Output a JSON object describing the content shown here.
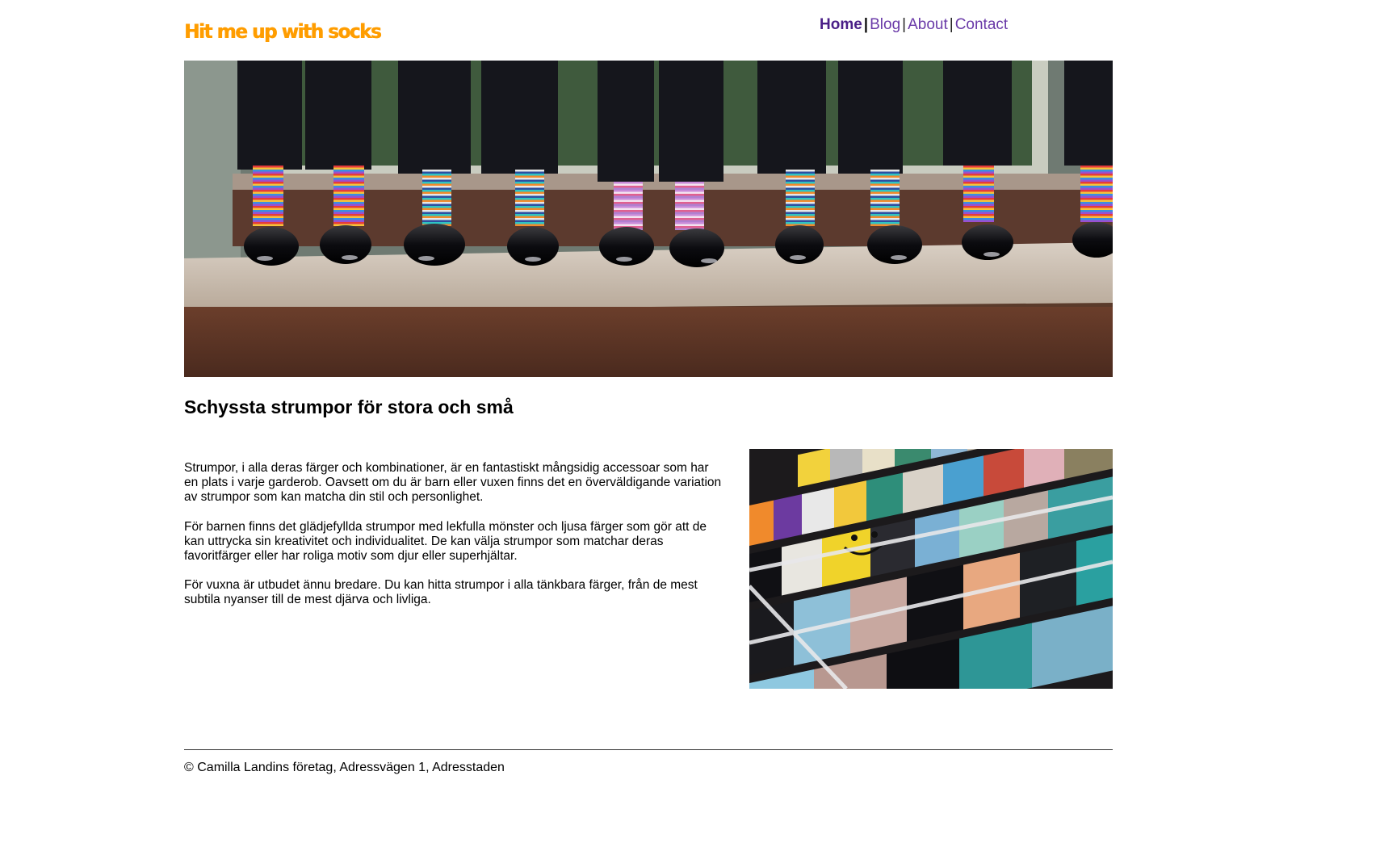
{
  "brand": {
    "logo_text": "Hit me up with socks",
    "accent_color": "#ff9d00"
  },
  "nav": {
    "items": [
      {
        "label": "Home",
        "active": true
      },
      {
        "label": "Blog",
        "active": false
      },
      {
        "label": "About",
        "active": false
      },
      {
        "label": "Contact",
        "active": false
      }
    ],
    "separator": "|",
    "link_color": "#6a3aa8"
  },
  "hero": {
    "image": "photo of rows of legs in black trousers wearing colorful striped socks and shiny black shoes on wooden steps"
  },
  "main": {
    "heading": "Schyssta strumpor för stora och små",
    "paragraphs": [
      "Strumpor, i alla deras färger och kombinationer, är en fantastiskt mångsidig accessoar som har en plats i varje garderob. Oavsett om du är barn eller vuxen finns det en överväldigande variation av strumpor som kan matcha din stil och personlighet.",
      "För barnen finns det glädjefyllda strumpor med lekfulla mönster och ljusa färger som gör att de kan uttrycka sin kreativitet och individualitet. De kan välja strumpor som matchar deras favoritfärger eller har roliga motiv som djur eller superhjältar.",
      "För vuxna är utbudet ännu bredare. Du kan hitta strumpor i alla tänkbara färger, från de mest subtila nyanser till de mest djärva och livliga."
    ],
    "side_image": "photo of many colorful socks hanging on a drying rack, one yellow sock with a smiling face"
  },
  "footer": {
    "text": "© Camilla Landins företag, Adressvägen 1, Adresstaden"
  }
}
